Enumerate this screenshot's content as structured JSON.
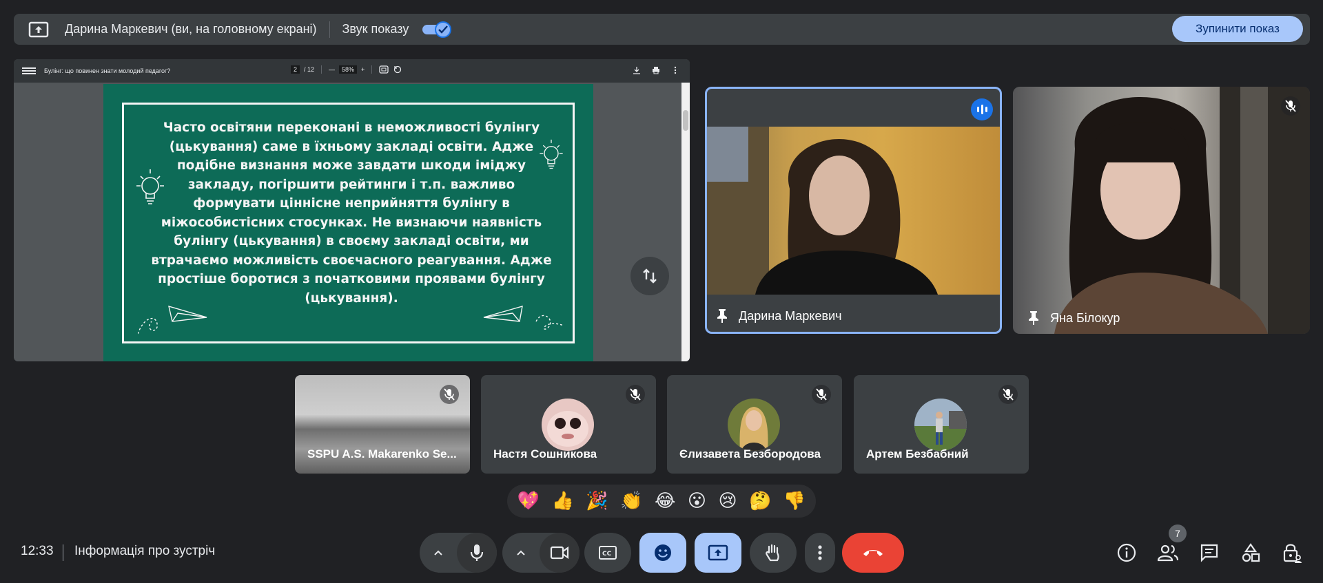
{
  "topbar": {
    "presenter_text": "Дарина Маркевич (ви, на головному екрані)",
    "audio_label": "Звук показу",
    "stop_button": "Зупинити показ"
  },
  "pdf": {
    "title": "Булінг: що повинен знати молодий педагог?",
    "page": "2",
    "page_total": "/ 12",
    "zoom": "58%",
    "minus": "—",
    "plus": "+"
  },
  "slide": {
    "text": "Часто освітяни переконані в неможливості булінгу (цькування) саме в їхньому закладі освіти. Адже подібне визнання може завдати шкоди іміджу закладу, погіршити рейтинги і т.п. важливо формувати ціннісне неприйняття булінгу в міжособистісних стосунках. Не визнаючи наявність булінгу (цькування) в своєму закладі освіти, ми втрачаємо можливість своєчасного реагування. Адже простіше боротися з початковими проявами булінгу (цькування)."
  },
  "participants": {
    "main": [
      {
        "name": "Дарина Маркевич"
      },
      {
        "name": "Яна Білокур"
      }
    ],
    "small": [
      {
        "name": "SSPU A.S. Makarenko Se..."
      },
      {
        "name": "Настя Сошникова"
      },
      {
        "name": "Єлизавета Безбородова"
      },
      {
        "name": "Артем Безбабний"
      }
    ]
  },
  "reactions": [
    "💖",
    "👍",
    "🎉",
    "👏",
    "😂",
    "😮",
    "😢",
    "🤔",
    "👎"
  ],
  "bottom": {
    "time": "12:33",
    "meeting_info": "Інформація про зустріч",
    "participant_count": "7"
  },
  "colors": {
    "background": "#202124",
    "accent": "#8ab4f8",
    "hangup": "#ea4335",
    "slide_green": "#0d6b57"
  }
}
